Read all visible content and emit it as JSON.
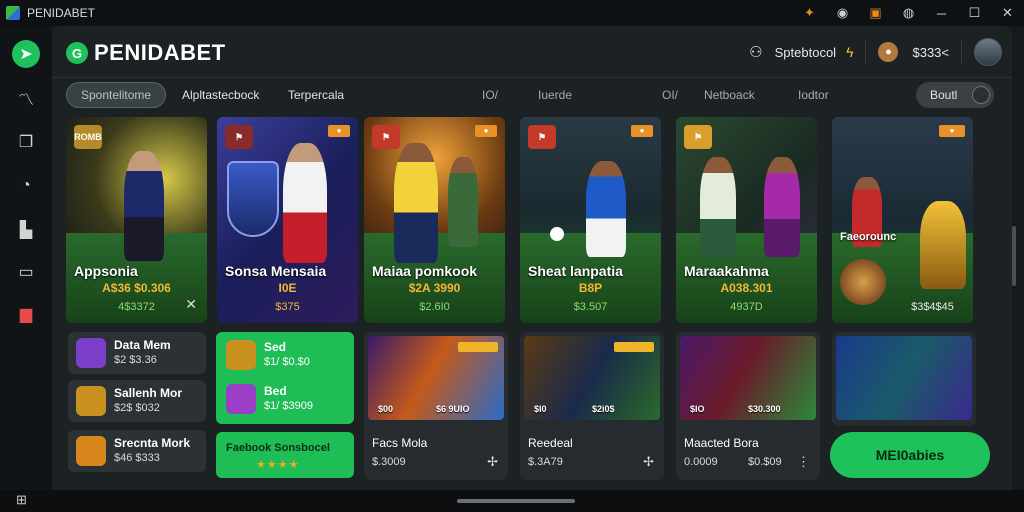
{
  "window": {
    "title": "PENIDABET",
    "controls": [
      "─",
      "☐",
      "✕"
    ]
  },
  "rail": {
    "items": [
      "home",
      "stats",
      "copy",
      "tennis",
      "bookmark",
      "folder",
      "gift"
    ]
  },
  "header": {
    "brand": "PENIDABET",
    "sportsbook": "Sptebtocol",
    "balance": "$333<",
    "logo_glyph": "G"
  },
  "tabs": [
    "Spontelitome",
    "Alpltastecbock",
    "Terpercala",
    "IO/",
    "Iuerde",
    "OI/",
    "Netboack",
    "Iodtor"
  ],
  "toggle_label": "Boutl",
  "cards": [
    {
      "title": "Appsonia",
      "odds": "A$36 $0.306",
      "sub": "4$3372",
      "badge": "ROMB",
      "accent": "#1c2a55"
    },
    {
      "title": "Sonsa Mensaia",
      "odds": "I0E",
      "sub": "$375",
      "badge": "",
      "accent": "#2b3c8a"
    },
    {
      "title": "Maiaa pomkook",
      "odds": "$2A 3990",
      "sub": "$2.6I0",
      "badge": "",
      "accent": "#6e3b12"
    },
    {
      "title": "Sheat lanpatia",
      "odds": "B8P",
      "sub": "$3.507",
      "badge": "",
      "accent": "#1d5a3a"
    },
    {
      "title": "Maraakahma",
      "odds": "A038.301",
      "sub": "4937D",
      "badge": "",
      "accent": "#4a2a62"
    },
    {
      "title": "Faeorounc",
      "odds": "",
      "sub": "$3$4$45",
      "badge": "",
      "accent": "#2a3d5a"
    }
  ],
  "mini_list": [
    {
      "name": "Data Mem",
      "value": "$2 $3.36",
      "color": "#7a3ec8"
    },
    {
      "name": "Sallenh Mor",
      "value": "$2$ $032",
      "color": "#c8901e"
    },
    {
      "name": "Srecnta Mork",
      "value": "$46 $333",
      "color": "#d8861e"
    }
  ],
  "promo": {
    "rows": [
      {
        "name": "Sed",
        "value": "$1/ $0.$0",
        "color": "#c8901e"
      },
      {
        "name": "Bed",
        "value": "$1/ $3909",
        "color": "#9a3ec8"
      }
    ],
    "footer_title": "Faebook Sonsbocel",
    "stars": "★★★★"
  },
  "tiles": [
    {
      "name": "Facs Mola",
      "value": "$.3009",
      "meta1": "$00",
      "meta2": "$6 9UIO",
      "icon": "✢"
    },
    {
      "name": "Reedeal",
      "value": "$.3A79",
      "meta1": "$I0",
      "meta2": "$2i0$",
      "icon": "✢"
    },
    {
      "name": "Maacted Bora",
      "value": "0.0009",
      "value2": "$0.$09",
      "meta1": "$IO",
      "meta2": "$30.300",
      "icon": "⋮"
    }
  ],
  "cta_label": "MEI0abies"
}
